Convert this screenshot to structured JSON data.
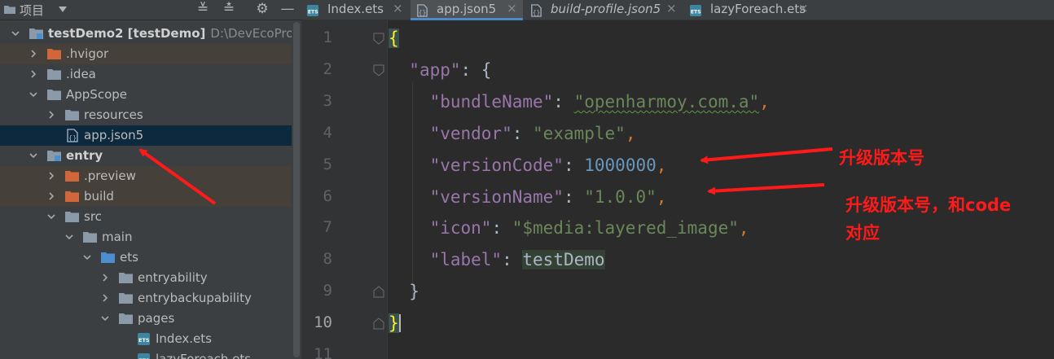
{
  "project_panel": {
    "title": "项目",
    "tools": [
      "≚",
      "≛",
      "⚙",
      "—"
    ],
    "tree": [
      {
        "label": "testDemo2",
        "module": "[testDemo]",
        "path": "D:\\DevEcoProject\\tes",
        "bold": true,
        "icon": "module-folder-icon",
        "expanded": true,
        "depth": 0
      },
      {
        "label": ".hvigor",
        "icon": "excluded-folder-icon",
        "expanded": false,
        "depth": 1,
        "highlight": true
      },
      {
        "label": ".idea",
        "icon": "folder-icon",
        "expanded": false,
        "depth": 1
      },
      {
        "label": "AppScope",
        "icon": "folder-icon",
        "expanded": true,
        "depth": 1
      },
      {
        "label": "resources",
        "icon": "folder-icon",
        "expanded": false,
        "depth": 2
      },
      {
        "label": "app.json5",
        "icon": "json5-file-icon",
        "depth": 2,
        "selected": true,
        "leaf": true
      },
      {
        "label": "entry",
        "icon": "module-folder-icon",
        "expanded": true,
        "depth": 1,
        "bold": true
      },
      {
        "label": ".preview",
        "icon": "excluded-folder-icon",
        "expanded": false,
        "depth": 2,
        "highlight": true
      },
      {
        "label": "build",
        "icon": "excluded-folder-icon",
        "expanded": false,
        "depth": 2,
        "highlight": true
      },
      {
        "label": "src",
        "icon": "folder-icon",
        "expanded": true,
        "depth": 2
      },
      {
        "label": "main",
        "icon": "folder-icon",
        "expanded": true,
        "depth": 3
      },
      {
        "label": "ets",
        "icon": "source-folder-icon",
        "expanded": true,
        "depth": 4
      },
      {
        "label": "entryability",
        "icon": "folder-icon",
        "expanded": false,
        "depth": 5
      },
      {
        "label": "entrybackupability",
        "icon": "folder-icon",
        "expanded": false,
        "depth": 5
      },
      {
        "label": "pages",
        "icon": "folder-icon",
        "expanded": true,
        "depth": 5
      },
      {
        "label": "Index.ets",
        "icon": "ets-file-icon",
        "depth": 6,
        "leaf": true
      },
      {
        "label": "lazyForeach.ets",
        "icon": "ets-file-icon",
        "depth": 6,
        "leaf": true
      }
    ]
  },
  "editor": {
    "tabs": [
      {
        "label": "Index.ets",
        "icon": "ets-file-icon",
        "active": false,
        "italic": false
      },
      {
        "label": "app.json5",
        "icon": "json5-file-icon",
        "active": true,
        "italic": false
      },
      {
        "label": "build-profile.json5",
        "icon": "json5-file-icon",
        "active": false,
        "italic": true
      },
      {
        "label": "lazyForeach.ets",
        "icon": "ets-file-icon",
        "active": false,
        "italic": false
      }
    ],
    "close_glyph": "×",
    "line_numbers": [
      "1",
      "2",
      "3",
      "4",
      "5",
      "6",
      "7",
      "8",
      "9",
      "10",
      "11"
    ],
    "current_line": "10",
    "code_lines": [
      [
        {
          "c": "brace-hl",
          "t": "{"
        }
      ],
      [
        {
          "c": "t",
          "t": "  "
        },
        {
          "c": "k",
          "t": "\"app\""
        },
        {
          "c": "t",
          "t": ": {"
        }
      ],
      [
        {
          "c": "t",
          "t": "    "
        },
        {
          "c": "k",
          "t": "\"bundleName\""
        },
        {
          "c": "t",
          "t": ": "
        },
        {
          "c": "s wave",
          "t": "\"openharmoy.com.a\""
        },
        {
          "c": "p",
          "t": ","
        }
      ],
      [
        {
          "c": "t",
          "t": "    "
        },
        {
          "c": "k",
          "t": "\"vendor\""
        },
        {
          "c": "t",
          "t": ": "
        },
        {
          "c": "s",
          "t": "\"example\""
        },
        {
          "c": "p",
          "t": ","
        }
      ],
      [
        {
          "c": "t",
          "t": "    "
        },
        {
          "c": "k",
          "t": "\"versionCode\""
        },
        {
          "c": "t",
          "t": ": "
        },
        {
          "c": "n",
          "t": "1000000"
        },
        {
          "c": "p",
          "t": ","
        }
      ],
      [
        {
          "c": "t",
          "t": "    "
        },
        {
          "c": "k",
          "t": "\"versionName\""
        },
        {
          "c": "t",
          "t": ": "
        },
        {
          "c": "s",
          "t": "\"1.0.0\""
        },
        {
          "c": "p",
          "t": ","
        }
      ],
      [
        {
          "c": "t",
          "t": "    "
        },
        {
          "c": "k",
          "t": "\"icon\""
        },
        {
          "c": "t",
          "t": ": "
        },
        {
          "c": "s",
          "t": "\"$media:layered_image\""
        },
        {
          "c": "p",
          "t": ","
        }
      ],
      [
        {
          "c": "t",
          "t": "    "
        },
        {
          "c": "k",
          "t": "\"label\""
        },
        {
          "c": "t",
          "t": ": "
        },
        {
          "c": "t ident-hl",
          "t": "testDemo"
        }
      ],
      [
        {
          "c": "t",
          "t": "  }"
        }
      ],
      [
        {
          "c": "brace-hl",
          "t": "}"
        }
      ],
      []
    ]
  },
  "annotations": {
    "note1": "升级版本号",
    "note2_line1": "升级版本号，和code",
    "note2_line2": "对应",
    "arrow_color": "#ff1a1a"
  },
  "colors": {
    "panel_bg": "#3c3f41",
    "editor_bg": "#2b2b2b",
    "gutter_bg": "#313335",
    "selection": "#0d293e",
    "accent": "#4a88c7"
  }
}
